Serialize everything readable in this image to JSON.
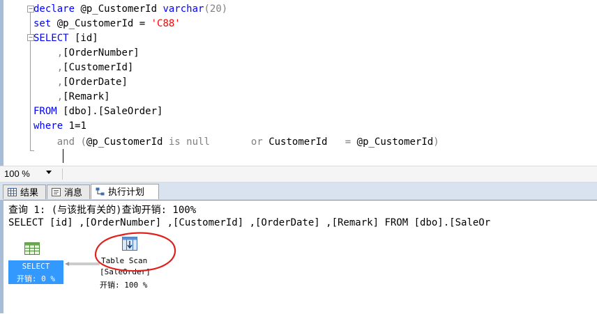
{
  "editor": {
    "lines": [
      {
        "id": "l1"
      },
      {
        "id": "l2"
      }
    ],
    "declare_kw": "declare",
    "declare_var": " @p_CustomerId ",
    "declare_type": "varchar",
    "declare_size": "(20)",
    "set_kw": "set",
    "set_var": " @p_CustomerId = ",
    "set_value": "'C88'",
    "select_kw": "SELECT",
    "col_id": " [id]",
    "col_order": "    ,[OrderNumber]",
    "col_customer": "    ,[CustomerId]",
    "col_date": "    ,[OrderDate]",
    "col_remark": "    ,[Remark]",
    "from_kw": "FROM",
    "from_table": " [dbo].[SaleOrder]",
    "where_kw": "where",
    "where_cond": " 1=1",
    "and_kw": "    and",
    "and_paren": " (",
    "and_var": "@p_CustomerId",
    "is_kw": " is",
    "null_kw": " null",
    "or_kw": "       or",
    "customer_col": " CustomerId",
    "eq": "   = ",
    "var2": "@p_CustomerId",
    "close_paren": ")"
  },
  "zoom": {
    "level": "100 %"
  },
  "tabs": [
    {
      "label": "结果"
    },
    {
      "label": "消息"
    },
    {
      "label": "执行计划"
    }
  ],
  "results": {
    "query_header": "查询 1: (与该批有关的)查询开销: 100%",
    "query_sql": "SELECT [id] ,[OrderNumber] ,[CustomerId] ,[OrderDate] ,[Remark] FROM [dbo].[SaleOr"
  },
  "plan": {
    "select_node": {
      "label": "SELECT",
      "cost": "开销: 0 %"
    },
    "scan_node": {
      "label": "Table Scan",
      "table": "[SaleOrder]",
      "cost": "开销: 100 %"
    },
    "colors": {
      "select_bg": "#3399ff",
      "annotation": "#e0201c"
    }
  }
}
